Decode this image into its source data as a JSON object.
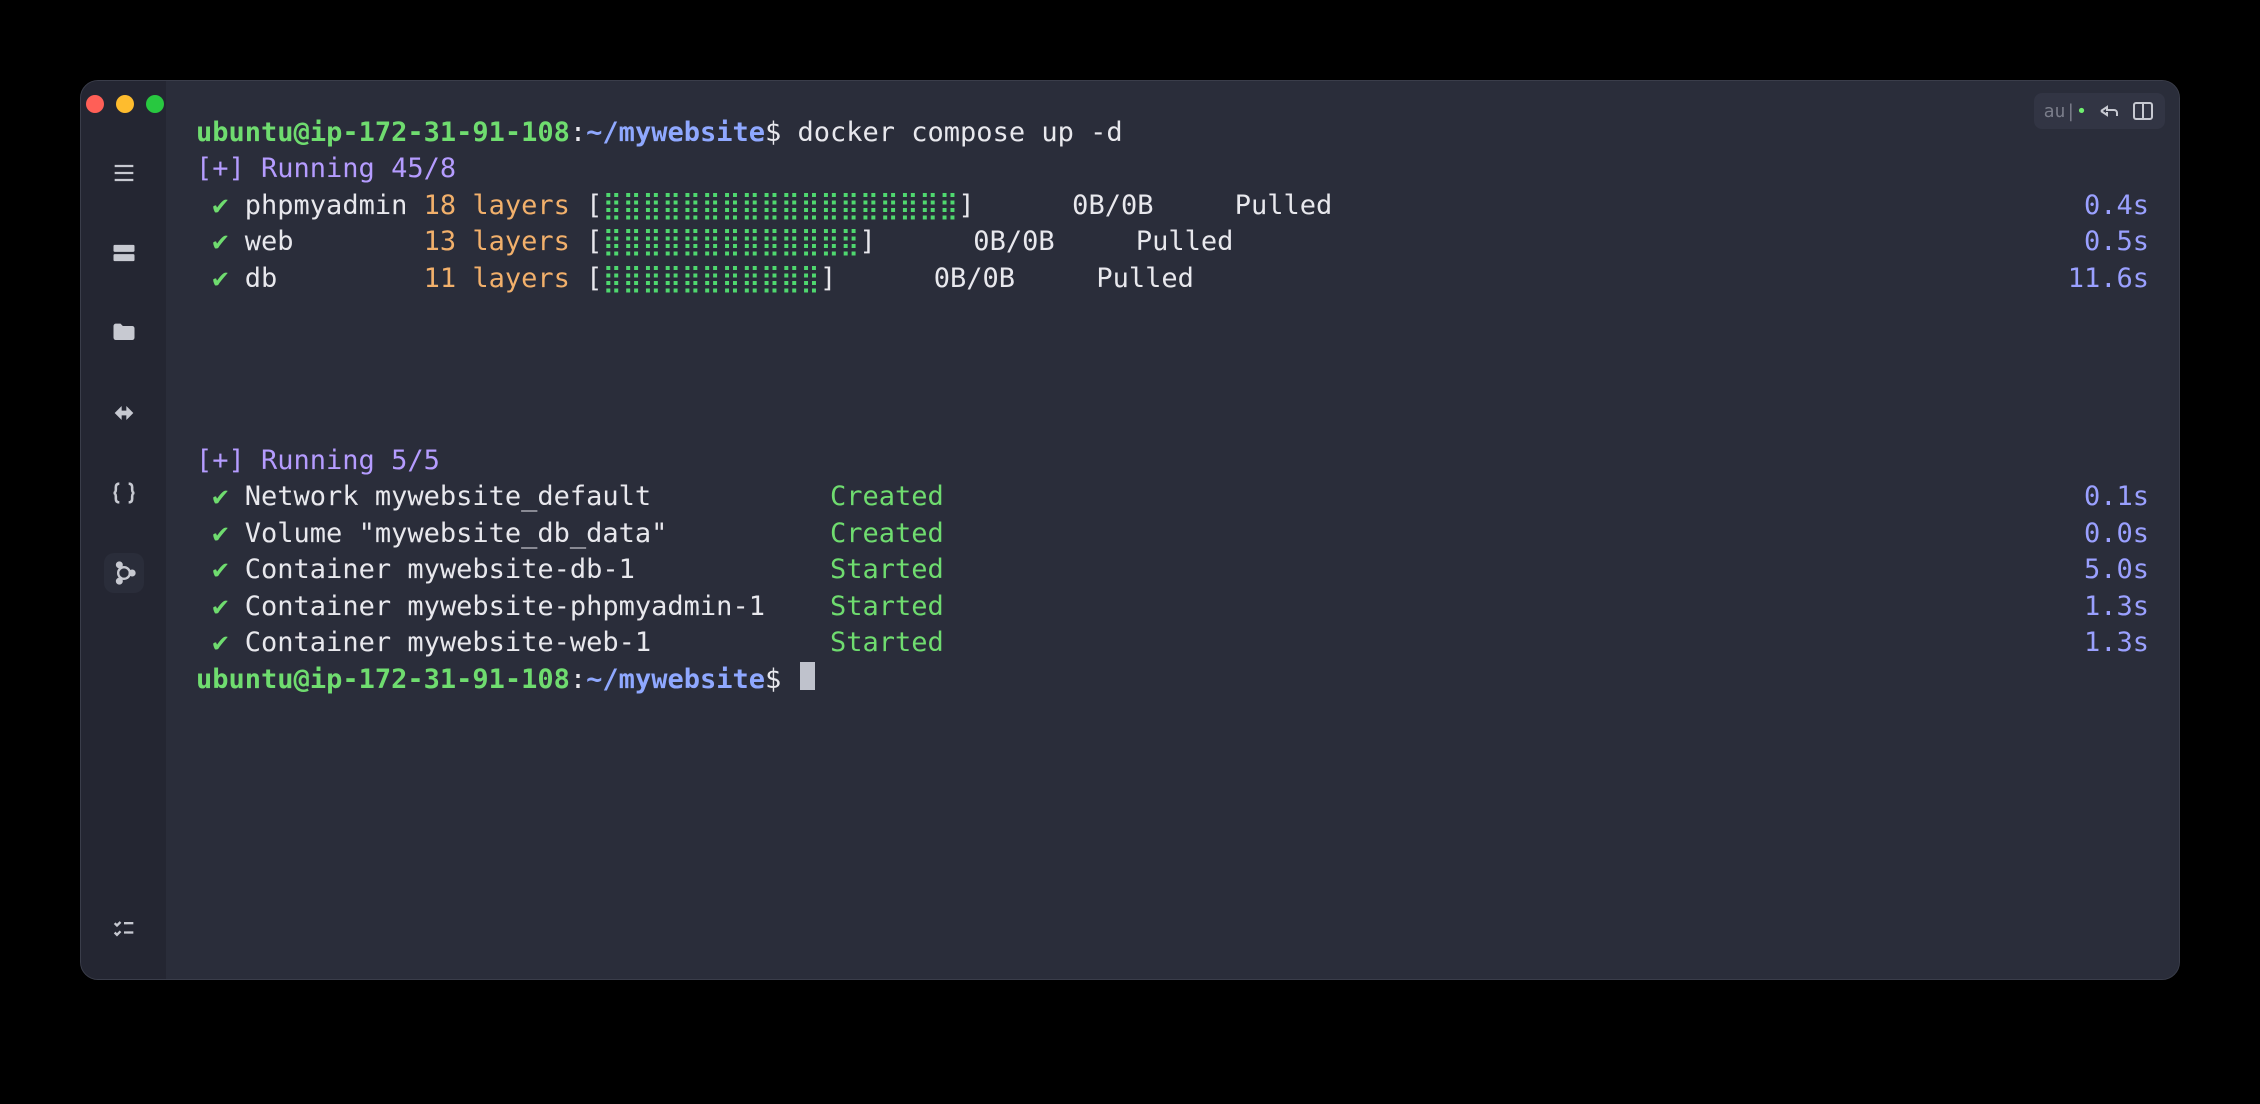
{
  "prompt": {
    "user": "ubuntu",
    "host": "ip-172-31-91-108",
    "path": "~/mywebsite",
    "symbol": "$"
  },
  "command": "docker compose up -d",
  "pull_header": "[+] Running 45/8",
  "pulls": [
    {
      "name": "phpmyadmin",
      "layers": "18 layers",
      "bar": "⣿⣿⣿⣿⣿⣿⣿⣿⣿⣿⣿⣿⣿⣿⣿⣿⣿⣿",
      "bytes": "0B/0B",
      "status": "Pulled",
      "time": "0.4s"
    },
    {
      "name": "web",
      "layers": "13 layers",
      "bar": "⣿⣿⣿⣿⣿⣿⣿⣿⣿⣿⣿⣿⣿",
      "bytes": "0B/0B",
      "status": "Pulled",
      "time": "0.5s"
    },
    {
      "name": "db",
      "layers": "11 layers",
      "bar": "⣿⣿⣿⣿⣿⣿⣿⣿⣿⣿⣿",
      "bytes": "0B/0B",
      "status": "Pulled",
      "time": "11.6s"
    }
  ],
  "run_header": "[+] Running 5/5",
  "steps": [
    {
      "kind": "Network",
      "name": "mywebsite_default",
      "status": "Created",
      "time": "0.1s"
    },
    {
      "kind": "Volume",
      "name": "\"mywebsite_db_data\"",
      "status": "Created",
      "time": "0.0s"
    },
    {
      "kind": "Container",
      "name": "mywebsite-db-1",
      "status": "Started",
      "time": "5.0s"
    },
    {
      "kind": "Container",
      "name": "mywebsite-phpmyadmin-1",
      "status": "Started",
      "time": "1.3s"
    },
    {
      "kind": "Container",
      "name": "mywebsite-web-1",
      "status": "Started",
      "time": "1.3s"
    }
  ],
  "topbar": {
    "label": "au|",
    "dot": "•"
  }
}
